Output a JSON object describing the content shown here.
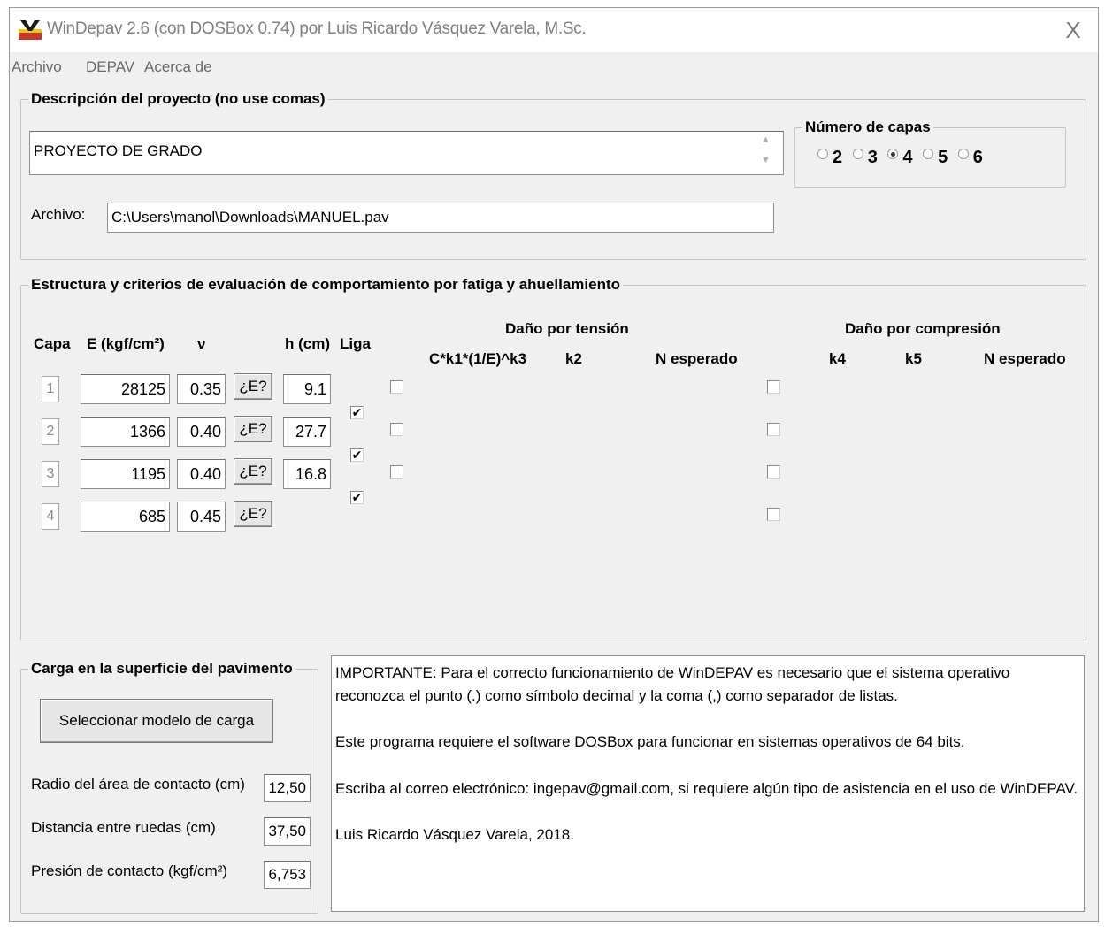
{
  "window": {
    "title": "WinDepav 2.6 (con DOSBox 0.74) por Luis Ricardo Vásquez Varela, M.Sc.",
    "close_glyph": "X"
  },
  "menu": [
    "Archivo",
    "DEPAV",
    "Acerca de"
  ],
  "project": {
    "legend": "Descripción del proyecto (no use comas)",
    "description": "PROYECTO DE GRADO",
    "file_label": "Archivo:",
    "file_path": "C:\\Users\\manol\\Downloads\\MANUEL.pav"
  },
  "layers_count": {
    "legend": "Número de capas",
    "options": [
      "2",
      "3",
      "4",
      "5",
      "6"
    ],
    "selected": "4"
  },
  "structure": {
    "legend": "Estructura y criterios de evaluación de comportamiento por fatiga y ahuellamiento",
    "headers": {
      "capa": "Capa",
      "e": "E (kgf/cm²)",
      "v": "ν",
      "h": "h (cm)",
      "liga": "Liga",
      "tension_title": "Daño por tensión",
      "tension_cols": [
        "C*k1*(1/E)^k3",
        "k2",
        "N esperado"
      ],
      "compresion_title": "Daño por compresión",
      "compresion_cols": [
        "k4",
        "k5",
        "N esperado"
      ]
    },
    "e_button_label": "¿E?",
    "rows": [
      {
        "capa": "1",
        "e": "28125",
        "v": "0.35",
        "h": "9.1"
      },
      {
        "capa": "2",
        "e": "1366",
        "v": "0.40",
        "h": "27.7"
      },
      {
        "capa": "3",
        "e": "1195",
        "v": "0.40",
        "h": "16.8"
      },
      {
        "capa": "4",
        "e": "685",
        "v": "0.45",
        "h": ""
      }
    ],
    "liga_checked": [
      true,
      true,
      true
    ],
    "tension_checked": [
      false,
      false,
      false
    ],
    "compresion_checked": [
      false,
      false,
      false,
      false
    ]
  },
  "load": {
    "legend": "Carga en la superficie del pavimento",
    "select_button": "Seleccionar modelo de carga",
    "fields": [
      {
        "label": "Radio del área de contacto (cm)",
        "value": "12,50"
      },
      {
        "label": "Distancia entre ruedas (cm)",
        "value": "37,50"
      },
      {
        "label": "Presión de contacto (kgf/cm²)",
        "value": "6,753"
      }
    ]
  },
  "info": [
    "IMPORTANTE: Para el correcto funcionamiento de WinDEPAV es necesario que el sistema operativo reconozca el punto (.) como símbolo decimal y la coma (,) como separador de listas.",
    "Este programa requiere el software DOSBox para funcionar en sistemas operativos de 64 bits.",
    "Escriba al correo electrónico: ingepav@gmail.com, si requiere algún tipo de asistencia en el uso de WinDEPAV.",
    "Luis Ricardo Vásquez Varela, 2018."
  ],
  "icons": {
    "app": "windepav-app-icon",
    "check_glyph": "✔"
  }
}
